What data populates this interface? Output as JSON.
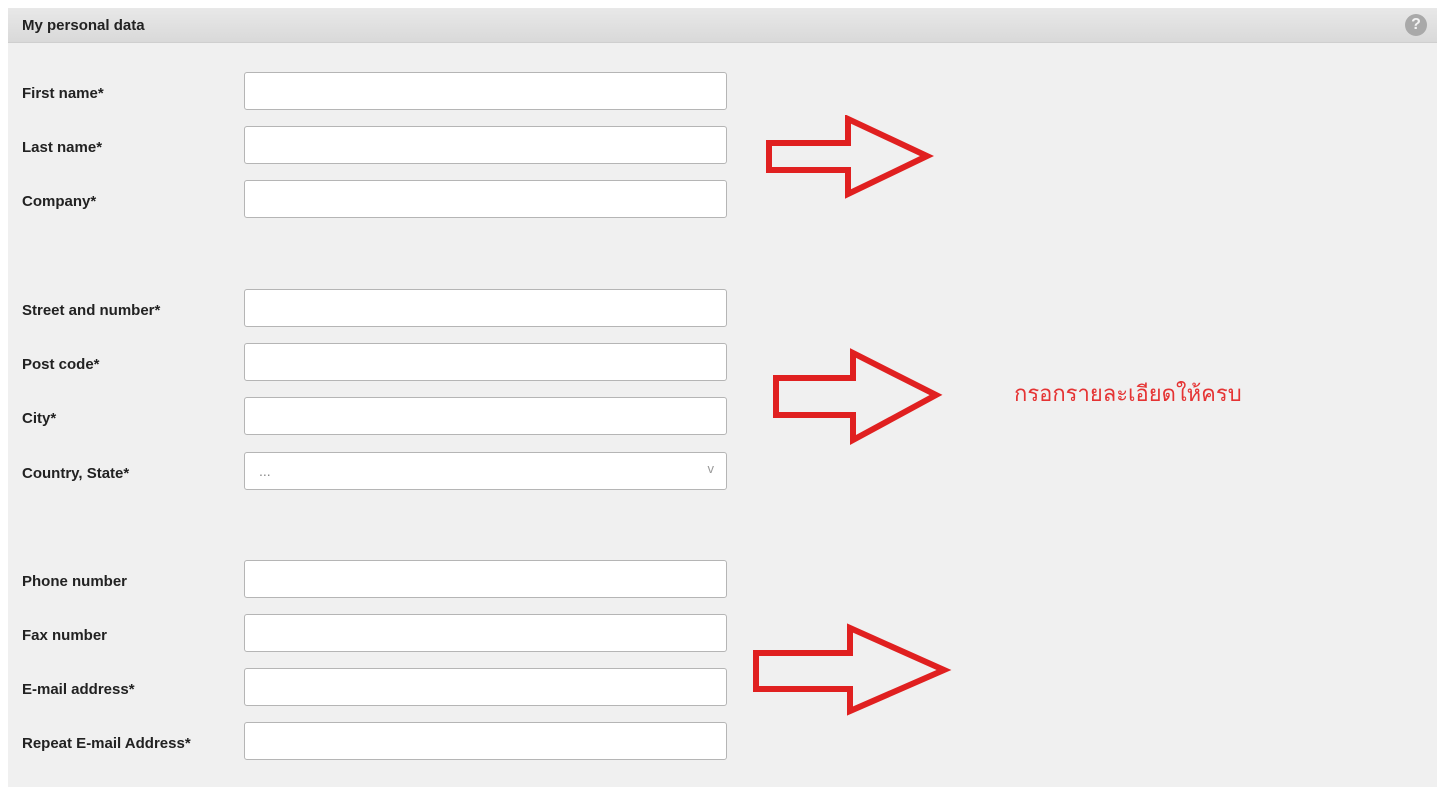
{
  "header": {
    "title": "My personal data",
    "help_icon": "question-mark-icon",
    "help_symbol": "?"
  },
  "fields": {
    "first_name": {
      "label": "First name*",
      "value": ""
    },
    "last_name": {
      "label": "Last name*",
      "value": ""
    },
    "company": {
      "label": "Company*",
      "value": ""
    },
    "street": {
      "label": "Street and number*",
      "value": ""
    },
    "post_code": {
      "label": "Post code*",
      "value": ""
    },
    "city": {
      "label": "City*",
      "value": ""
    },
    "country": {
      "label": "Country, State*",
      "selected": "...",
      "chevron": "v"
    },
    "phone": {
      "label": "Phone number",
      "value": ""
    },
    "fax": {
      "label": "Fax number",
      "value": ""
    },
    "email": {
      "label": "E-mail address*",
      "value": ""
    },
    "email_repeat": {
      "label": "Repeat E-mail Address*",
      "value": ""
    }
  },
  "annotation": {
    "text": "กรอกรายละเอียดให้ครบ",
    "color": "#e53333"
  },
  "colors": {
    "panel_bg": "#f0f0f0",
    "header_bg": "#dcdcdc",
    "arrow": "#e02020"
  }
}
